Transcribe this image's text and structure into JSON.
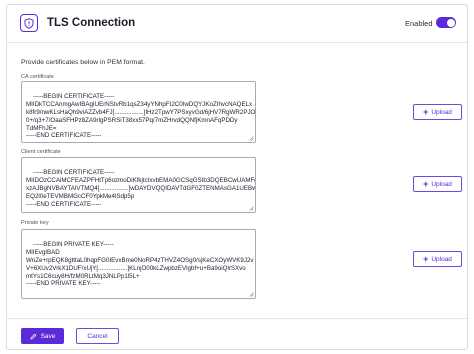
{
  "header": {
    "icon": "shield-icon",
    "title": "TLS Connection",
    "enabled_label": "Enabled",
    "enabled": true
  },
  "intro": "Provide certificates below in PEM format.",
  "fields": [
    {
      "label": "CA certificate",
      "value": "-----BEGIN CERTIFICATE-----\nMIIDkTCCAnmgAwIBAgIUErNStvRb1qsZ34yYNhpFI2C0IwDQYJKoZIhvcNAQELx\nk8fr9/nwKLsHaQh9viAZZvb4FJ[.................]IHz2TpwY7PSxyvGd/6jHV7RgWR2PJO\n0+/q3+7/OaaSFHPz8ZA9rlgPSRSiT38xx57Pq/7mZHrvdQQNfjKmnAFqPDDy\nTdMFhJE=\n-----END CERTIFICATE-----",
      "upload_label": "Upload"
    },
    {
      "label": "Client certificate",
      "value": "-----BEGIN CERTIFICATE-----\nMIIDOzCCAiMCFEAZPFHtTp6ozmoDiKfkjtcIxvbEMA0GCSqGSIb3DQEBCwUAMFg\nxzAJBgNVBAYTAlVTMQ4[.................]wDAYDVQQIDAVTdGF0ZTENMAsGA1UEBww\nEQ2l0eTEVMBMGcCF0YpkMe4lSdp5p\n-----END CERTIFICATE-----",
      "upload_label": "Upload"
    },
    {
      "label": "Private key",
      "value": "-----BEGIN PRIVATE KEY-----\nMIIEvgIBAD\nWnZe+rpEQK8gtttaL0hqpFG0IEvxBme0NoRP4zTHVZ4OSg0/sjKeCXOyWVK9J2v\nV+6XUv2VrkX1DUF/xUjY[.................]KLnjO00kLZwpbzEVlgbf+u+Ba9oiQlrSXvo\nmtYs1C6cuy8H/fzM0RLtMq3JNLPp1l5L+\n-----END PRIVATE KEY-----",
      "upload_label": "Upload"
    }
  ],
  "footer": {
    "save_label": "Save",
    "cancel_label": "Cancel"
  },
  "colors": {
    "accent": "#5a2bd6",
    "border": "#dcdce3"
  }
}
